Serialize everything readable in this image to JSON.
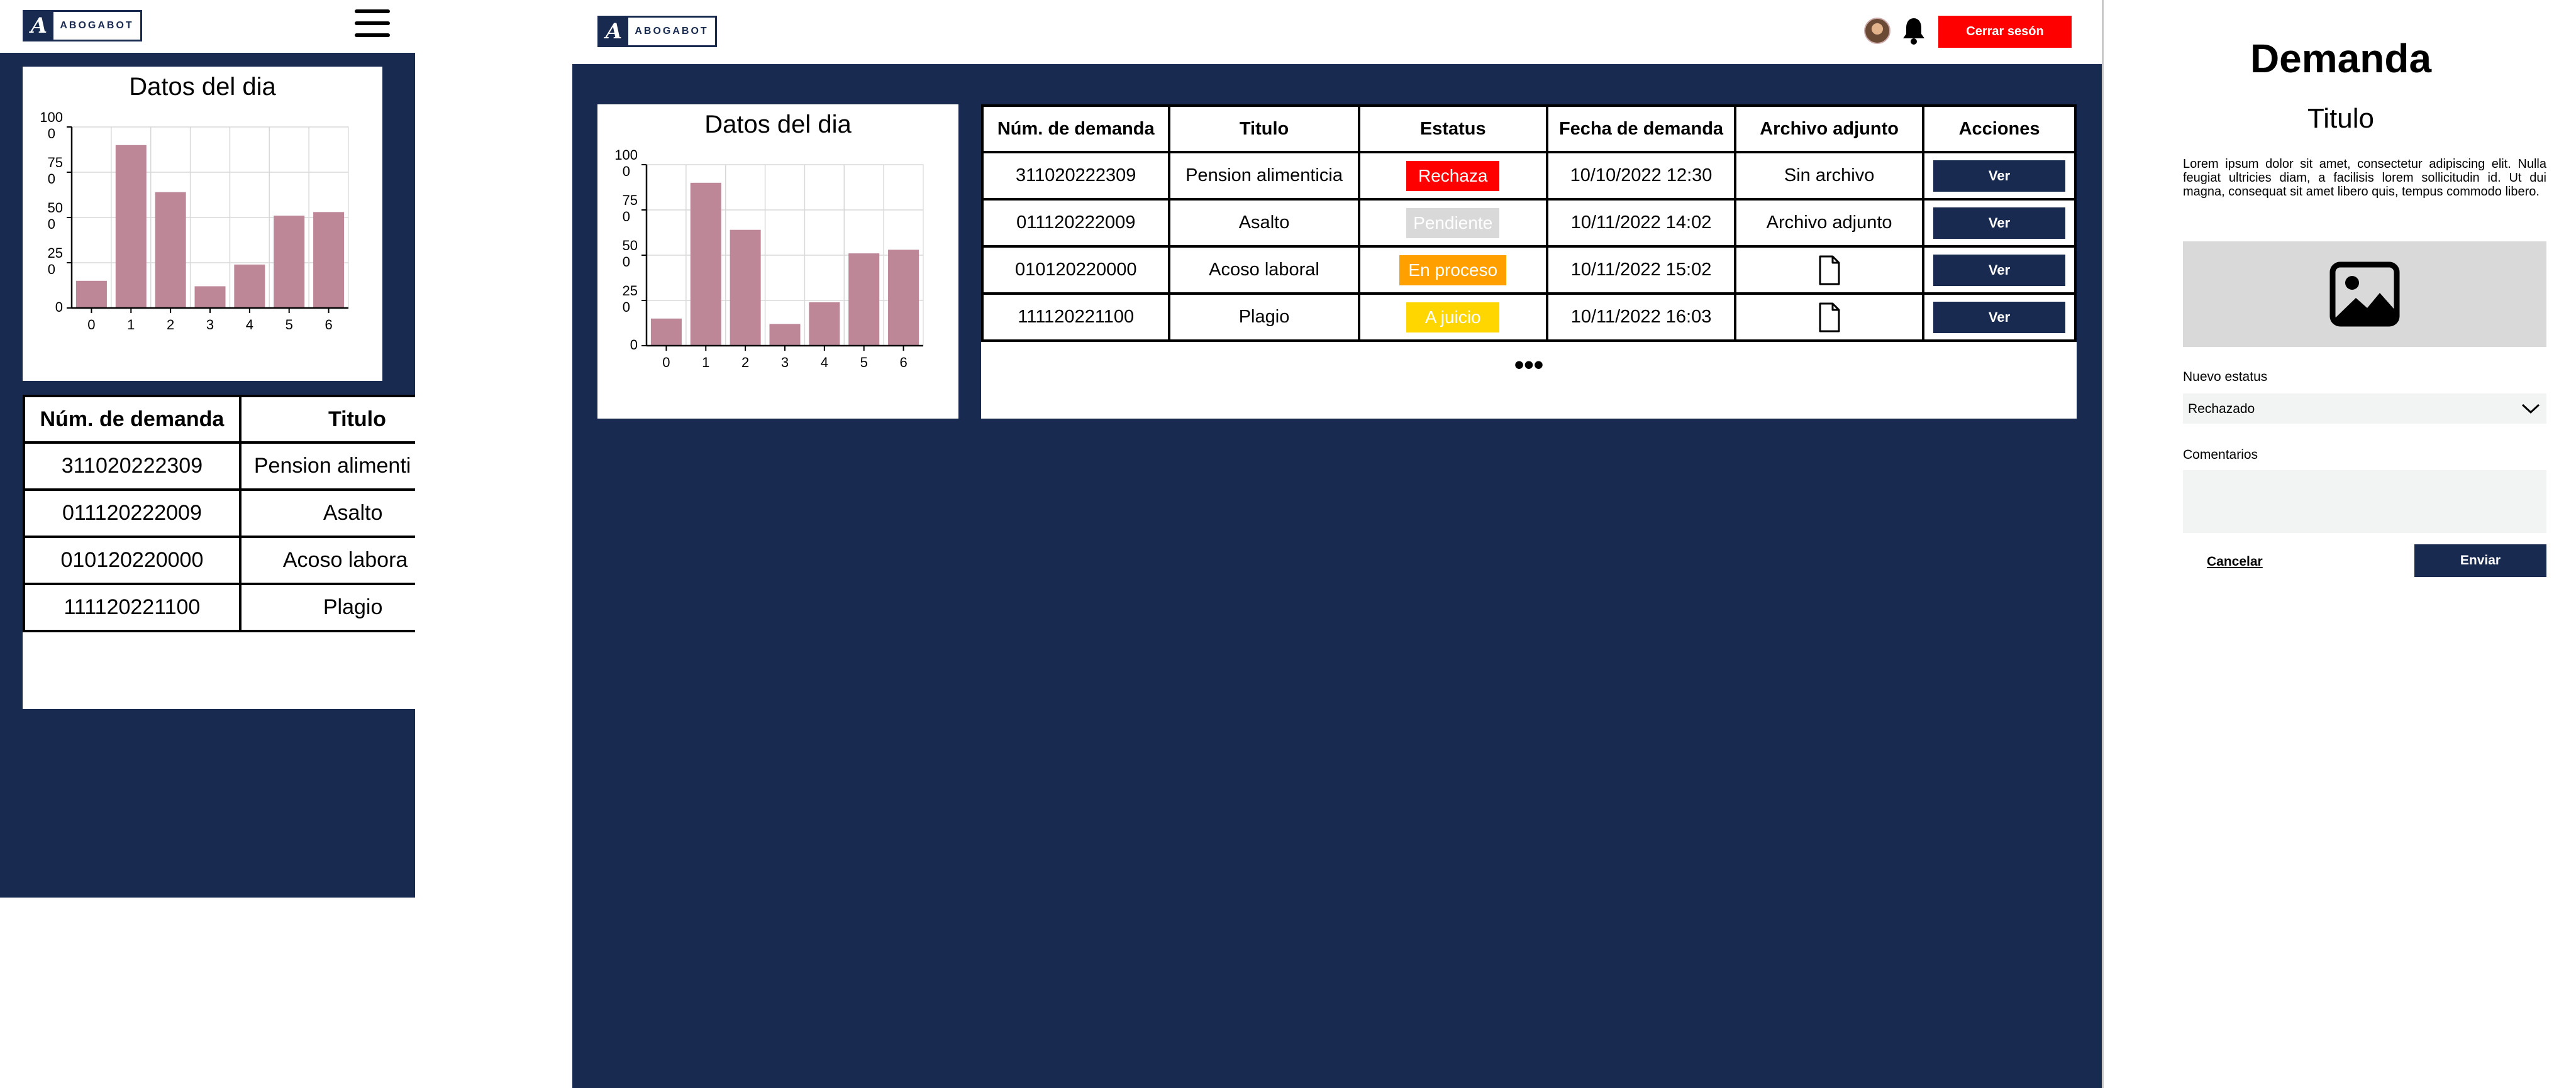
{
  "brand": {
    "logo_letter": "A",
    "logo_word": "ABOGABOT"
  },
  "header": {
    "logout_label": "Cerrar sesón"
  },
  "colors": {
    "navy": "#182a4f",
    "bar": "#bd8798",
    "rechaza": "#ff0000",
    "pendiente": "#d9d9d9",
    "en_proceso": "#ffa000",
    "a_juicio": "#ffd600",
    "logout": "#ff0000"
  },
  "chart_title": "Datos del dia",
  "chart_data": {
    "type": "bar",
    "title": "Datos del dia",
    "categories": [
      "0",
      "1",
      "2",
      "3",
      "4",
      "5",
      "6"
    ],
    "values": [
      15,
      90,
      64,
      12,
      24,
      51,
      53
    ],
    "ylim": [
      0,
      100
    ],
    "yticks": [
      "0",
      "25\n0",
      "50\n0",
      "75\n0",
      "100\n0"
    ],
    "grid": true
  },
  "table": {
    "headers": [
      "Núm. de demanda",
      "Titulo",
      "Estatus",
      "Fecha de demanda",
      "Archivo adjunto",
      "Acciones"
    ],
    "rows": [
      {
        "num": "311020222309",
        "titulo": "Pension alimenticia",
        "estatus": "Rechaza",
        "fecha": "10/10/2022 12:30",
        "archivo": "Sin archivo",
        "accion": "Ver"
      },
      {
        "num": "011120222009",
        "titulo": "Asalto",
        "estatus": "Pendiente",
        "fecha": "10/11/2022 14:02",
        "archivo": "Archivo adjunto",
        "accion": "Ver"
      },
      {
        "num": "010120220000",
        "titulo": "Acoso laboral",
        "estatus": "En proceso",
        "fecha": "10/11/2022 15:02",
        "archivo": "file-icon",
        "accion": "Ver"
      },
      {
        "num": "111120221100",
        "titulo": "Plagio",
        "estatus": "A juicio",
        "fecha": "10/11/2022 16:03",
        "archivo": "file-icon",
        "accion": "Ver"
      }
    ],
    "more": "•••"
  },
  "mobile": {
    "headers": [
      "Núm. de demanda",
      "Titulo"
    ],
    "rows": [
      {
        "num": "311020222309",
        "titulo": "Pension alimenti"
      },
      {
        "num": "011120222009",
        "titulo": "Asalto"
      },
      {
        "num": "010120220000",
        "titulo": "Acoso labora"
      },
      {
        "num": "111120221100",
        "titulo": "Plagio"
      }
    ]
  },
  "panel": {
    "title": "Demanda",
    "subtitle": "Titulo",
    "body": "Lorem ipsum dolor sit amet, consectetur adipiscing elit. Nulla feugiat ultricies diam, a facilisis lorem sollicitudin id. Ut dui magna, consequat sit amet libero quis, tempus commodo libero.",
    "status_label": "Nuevo estatus",
    "status_value": "Rechazado",
    "comments_label": "Comentarios",
    "comments_value": "",
    "cancel_label": "Cancelar",
    "send_label": "Enviar"
  }
}
